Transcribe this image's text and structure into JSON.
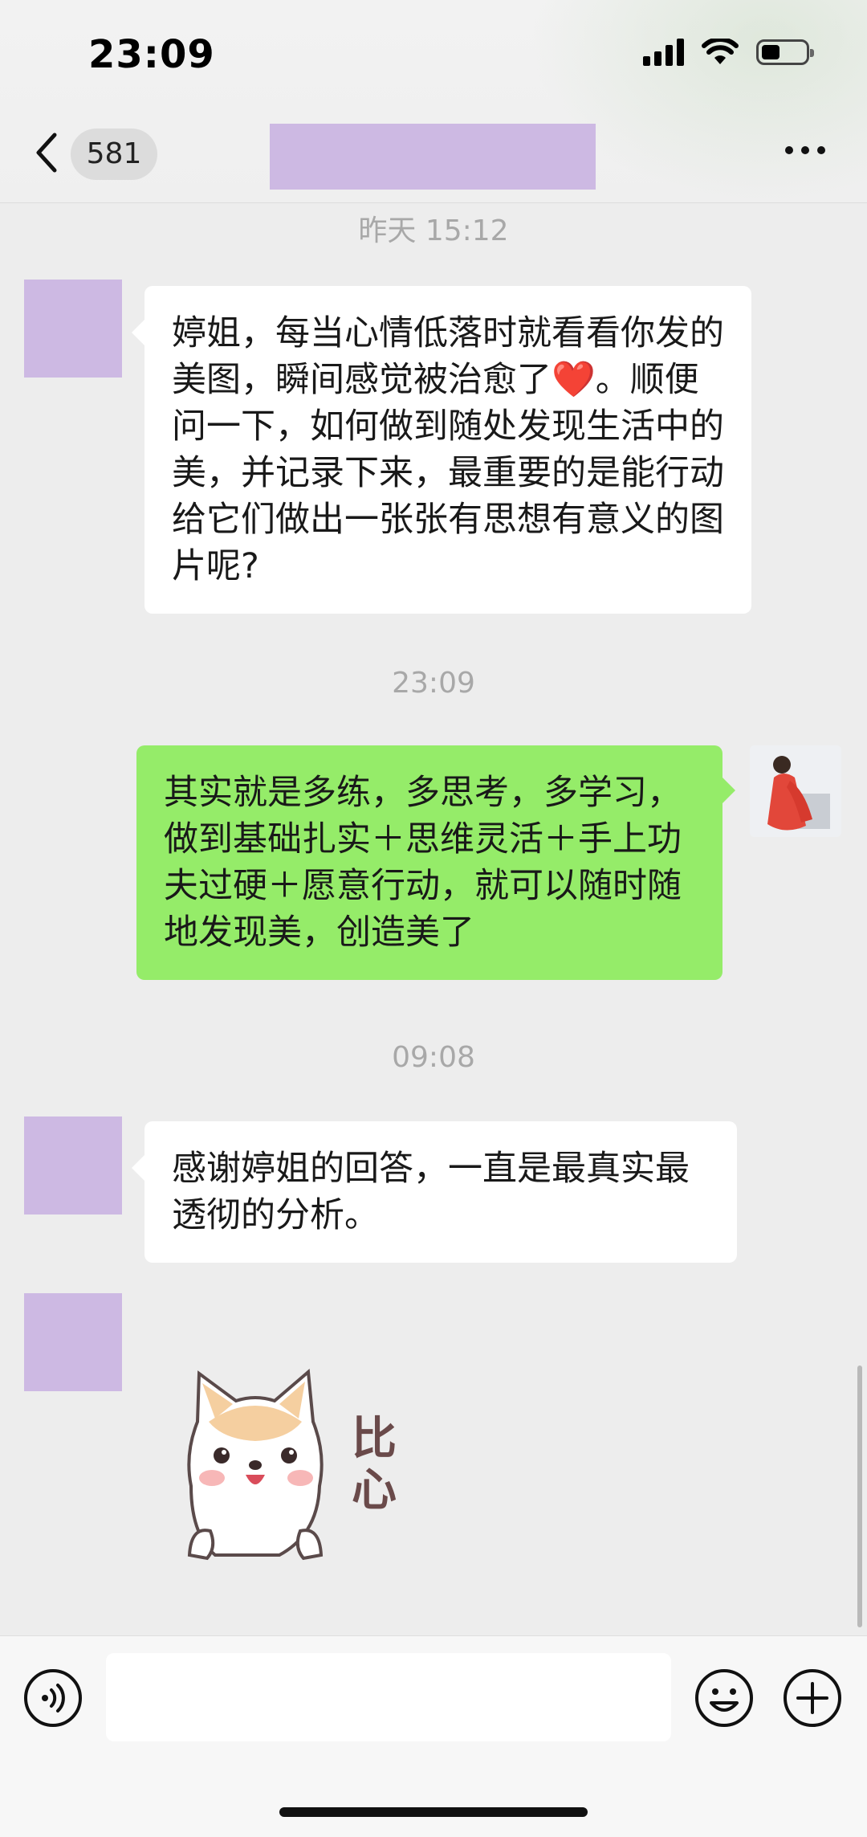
{
  "status_bar": {
    "time": "23:09"
  },
  "header": {
    "unread_count": "581",
    "title": ""
  },
  "messages": [
    {
      "timestamp": "昨天 15:12"
    },
    {
      "from": "other",
      "text_before_emoji": "婷姐，每当心情低落时就看看你发的美图，瞬间感觉被治愈了",
      "emoji": "❤️",
      "text_after_emoji": "。顺便问一下，如何做到随处发现生活中的美，并记录下来，最重要的是能行动给它们做出一张张有思想有意义的图片呢?"
    },
    {
      "timestamp": "23:09"
    },
    {
      "from": "self",
      "text": "其实就是多练，多思考，多学习，做到基础扎实＋思维灵活＋手上功夫过硬＋愿意行动，就可以随时随地发现美，创造美了"
    },
    {
      "timestamp": "09:08"
    },
    {
      "from": "other",
      "text": "感谢婷姐的回答，一直是最真实最透彻的分析。"
    },
    {
      "from": "other",
      "sticker": "puppy-heart",
      "sticker_text": "比心"
    }
  ],
  "colors": {
    "chat_bg": "#ededed",
    "incoming_bubble": "#ffffff",
    "outgoing_bubble": "#95ec69",
    "redaction": "#cdb9e3"
  },
  "icons": [
    "back-chevron-icon",
    "more-dots-icon",
    "voice-icon",
    "emoji-icon",
    "plus-icon",
    "signal-icon",
    "wifi-icon",
    "battery-icon"
  ]
}
